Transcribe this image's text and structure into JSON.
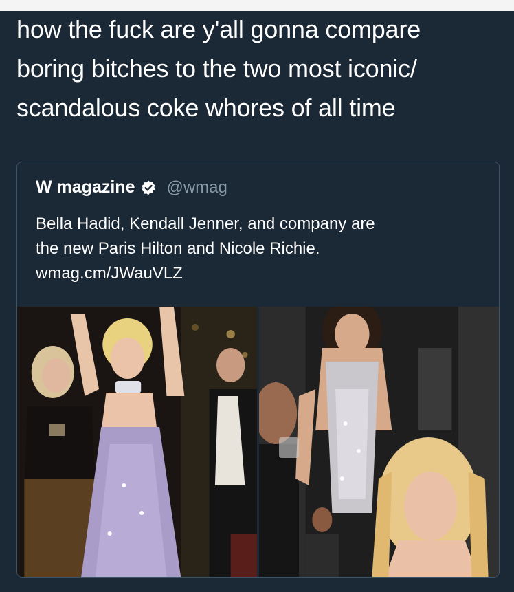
{
  "tweet": {
    "text_line1": "how the fuck are y'all gonna compare",
    "text_line2": "boring bitches to the two most iconic/",
    "text_line3": "scandalous coke whores of all time"
  },
  "quoted_tweet": {
    "name": "W magazine",
    "verified_icon": "verified-badge-icon",
    "handle": "@wmag",
    "body_line1": "Bella Hadid, Kendall Jenner, and company are",
    "body_line2": "the new Paris Hilton and Nicole Richie.",
    "body_line3": "wmag.cm/JWauVLZ"
  },
  "colors": {
    "background": "#1b2836",
    "card_border": "#3d5466",
    "handle": "#8899a6",
    "text": "#ffffff"
  }
}
